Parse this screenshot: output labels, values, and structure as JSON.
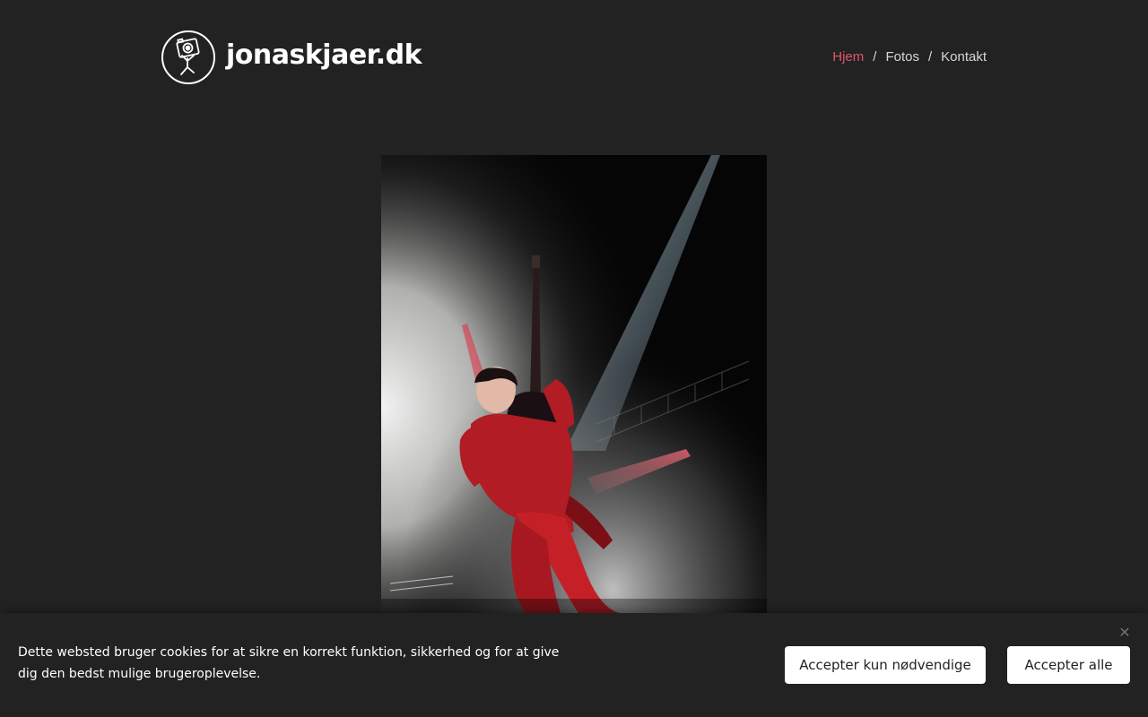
{
  "header": {
    "site_name": "jonaskjaer.dk",
    "logo_icon": "camera-stickfigure-icon",
    "nav": [
      {
        "label": "Hjem",
        "active": true
      },
      {
        "label": "Fotos",
        "active": false
      },
      {
        "label": "Kontakt",
        "active": false
      }
    ],
    "nav_separator": "/"
  },
  "main": {
    "photo_subject": "concert-guitarist-photo"
  },
  "cookie_banner": {
    "message": "Dette websted bruger cookies for at sikre en korrekt funktion, sikkerhed og for at give dig den bedst mulige brugeroplevelse.",
    "close_symbol": "✕",
    "necessary_label": "Accepter kun nødvendige",
    "accept_all_label": "Accepter alle"
  },
  "colors": {
    "background": "#222222",
    "nav_active": "#e0566b",
    "nav_text": "#d6d6d6",
    "button_bg": "#ffffff"
  }
}
